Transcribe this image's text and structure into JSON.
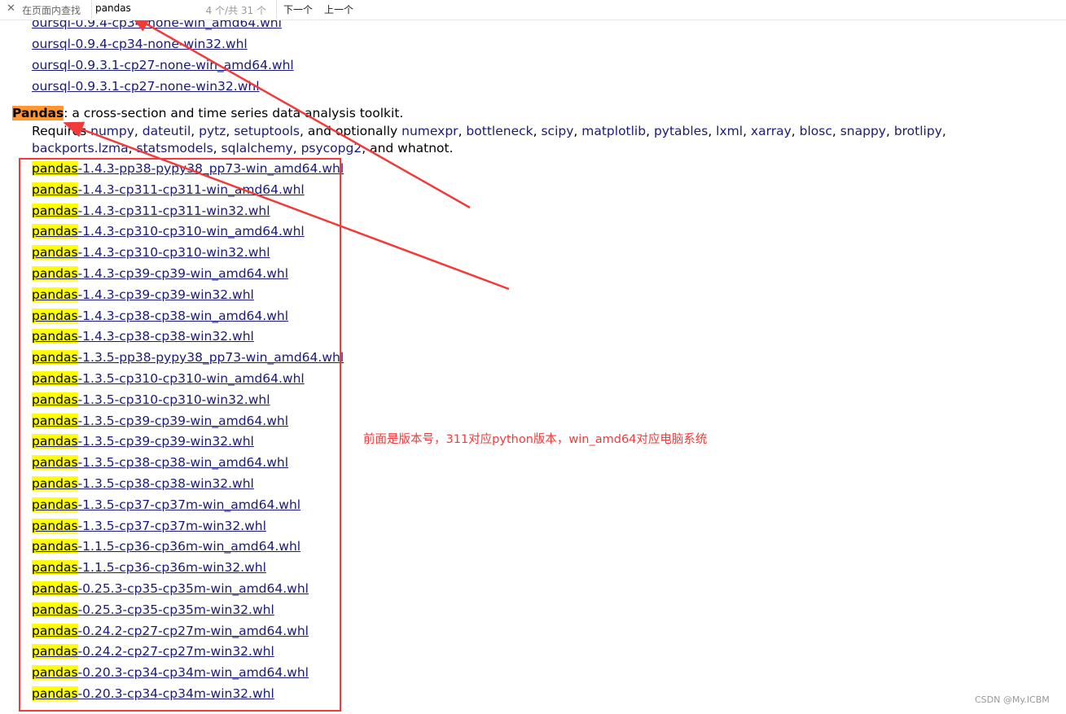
{
  "findbar": {
    "close_icon": "close-icon",
    "label": "在页面内查找",
    "query": "pandas",
    "match_count": "4 个/共 31 个",
    "next_label": "下一个",
    "prev_label": "上一个"
  },
  "oursql_links": [
    "oursql-0.9.4-cp34-none-win_amd64.whl",
    "oursql-0.9.4-cp34-none-win32.whl",
    "oursql-0.9.3.1-cp27-none-win_amd64.whl",
    "oursql-0.9.3.1-cp27-none-win32.whl"
  ],
  "pandas_section": {
    "name": "Pandas",
    "description": ": a cross-section and time series data analysis toolkit.",
    "requires_prefix": "Requires ",
    "requires": [
      "numpy",
      "dateutil",
      "pytz",
      "setuptools"
    ],
    "optional_prefix": ", and optionally ",
    "optional": [
      "numexpr",
      "bottleneck",
      "scipy",
      "matplotlib",
      "pytables",
      "lxml",
      "xarray",
      "blosc",
      "snappy",
      "brotlipy",
      "backports.lzma",
      "statsmodels",
      "sqlalchemy",
      "psycopg2"
    ],
    "suffix": ", and whatnot.",
    "highlight_term": "pandas",
    "files": [
      "-1.4.3-pp38-pypy38_pp73-win_amd64.whl",
      "-1.4.3-cp311-cp311-win_amd64.whl",
      "-1.4.3-cp311-cp311-win32.whl",
      "-1.4.3-cp310-cp310-win_amd64.whl",
      "-1.4.3-cp310-cp310-win32.whl",
      "-1.4.3-cp39-cp39-win_amd64.whl",
      "-1.4.3-cp39-cp39-win32.whl",
      "-1.4.3-cp38-cp38-win_amd64.whl",
      "-1.4.3-cp38-cp38-win32.whl",
      "-1.3.5-pp38-pypy38_pp73-win_amd64.whl",
      "-1.3.5-cp310-cp310-win_amd64.whl",
      "-1.3.5-cp310-cp310-win32.whl",
      "-1.3.5-cp39-cp39-win_amd64.whl",
      "-1.3.5-cp39-cp39-win32.whl",
      "-1.3.5-cp38-cp38-win_amd64.whl",
      "-1.3.5-cp38-cp38-win32.whl",
      "-1.3.5-cp37-cp37m-win_amd64.whl",
      "-1.3.5-cp37-cp37m-win32.whl",
      "-1.1.5-cp36-cp36m-win_amd64.whl",
      "-1.1.5-cp36-cp36m-win32.whl",
      "-0.25.3-cp35-cp35m-win_amd64.whl",
      "-0.25.3-cp35-cp35m-win32.whl",
      "-0.24.2-cp27-cp27m-win_amd64.whl",
      "-0.24.2-cp27-cp27m-win32.whl",
      "-0.20.3-cp34-cp34m-win_amd64.whl",
      "-0.20.3-cp34-cp34m-win32.whl"
    ]
  },
  "annotation": {
    "text": "前面是版本号，311对应python版本，win_amd64对应电脑系统",
    "color": "#f23a3a"
  },
  "watermark": "CSDN @My.ICBM",
  "colors": {
    "link": "#1a1a7a",
    "find_highlight": "#ffff00",
    "active_highlight": "#ff9632",
    "annotation_red": "#f23a3a"
  }
}
